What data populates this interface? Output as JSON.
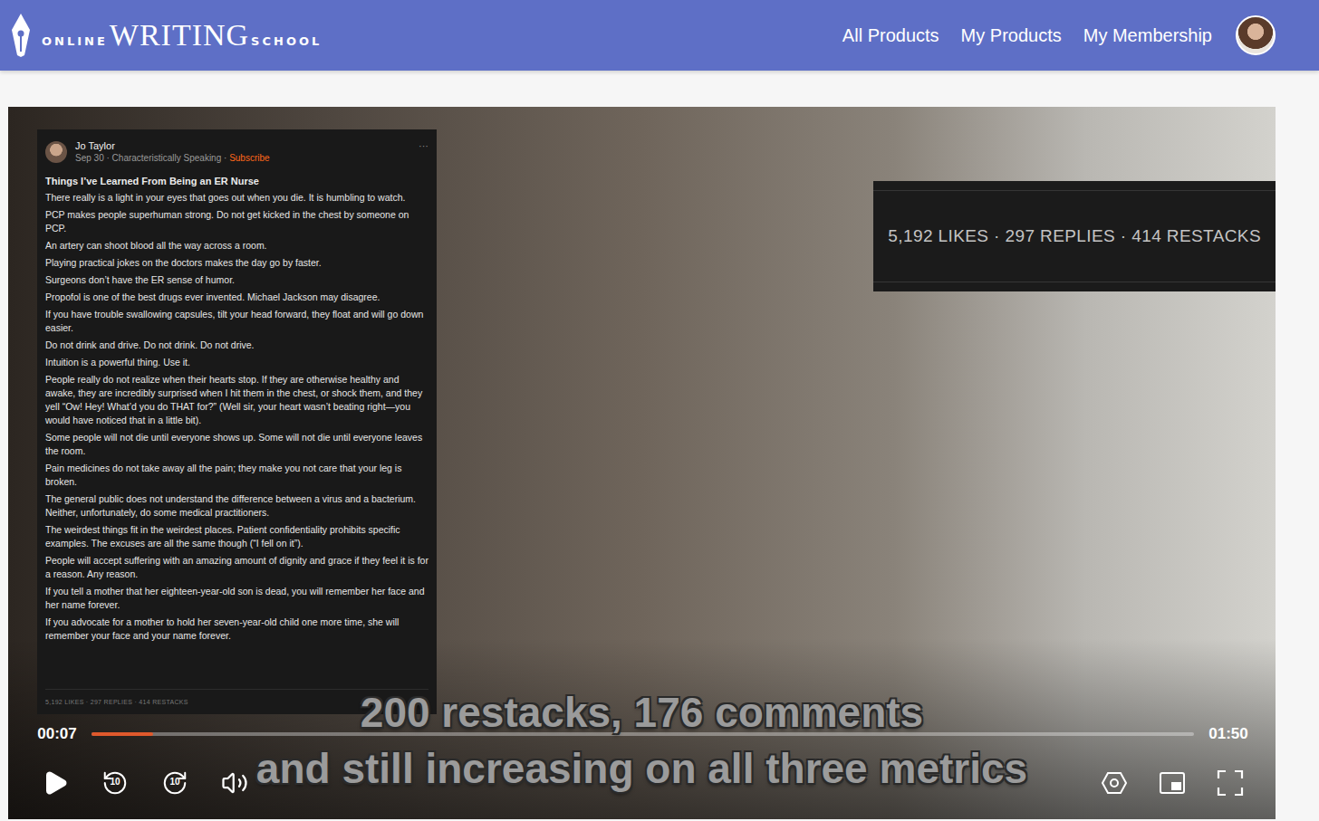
{
  "header": {
    "logo": {
      "prefix": "ONLINE",
      "main": "WRITING",
      "suffix": "SCHOOL"
    },
    "nav": [
      {
        "label": "All Products",
        "selected": false
      },
      {
        "label": "My Products",
        "selected": false
      },
      {
        "label": "My Membership",
        "selected": false
      }
    ]
  },
  "video": {
    "note": {
      "author": "Jo Taylor",
      "date": "Sep 30",
      "separator": "·",
      "publication": "Characteristically Speaking",
      "subscribe": "Subscribe",
      "more": "···",
      "title": "Things I’ve Learned From Being an ER Nurse",
      "items": [
        "There really is a light in your eyes that goes out when you die. It is humbling to watch.",
        "PCP makes people superhuman strong. Do not get kicked in the chest by someone on PCP.",
        "An artery can shoot blood all the way across a room.",
        "Playing practical jokes on the doctors makes the day go by faster.",
        "Surgeons don’t have the ER sense of humor.",
        "Propofol is one of the best drugs ever invented. Michael Jackson may disagree.",
        "If you have trouble swallowing capsules, tilt your head forward, they float and will go down easier.",
        "Do not drink and drive. Do not drink. Do not drive.",
        "Intuition is a powerful thing. Use it.",
        "People really do not realize when their hearts stop. If they are otherwise healthy and awake, they are incredibly surprised when I hit them in the chest, or shock them, and they yell “Ow! Hey! What’d you do THAT for?” (Well sir, your heart wasn’t beating right—you would have noticed that in a little bit).",
        "Some people will not die until everyone shows up. Some will not die until everyone leaves the room.",
        "Pain medicines do not take away all the pain; they make you not care that your leg is broken.",
        "The general public does not understand the difference between a virus and a bacterium. Neither, unfortunately, do some medical practitioners.",
        "The weirdest things fit in the weirdest places. Patient confidentiality prohibits specific examples. The excuses are all the same though (“I fell on it”).",
        "People will accept suffering with an amazing amount of dignity and grace if they feel it is for a reason. Any reason.",
        "If you tell a mother that her eighteen-year-old son is dead, you will remember her face and her name forever.",
        "If you advocate for a mother to hold her seven-year-old child one more time, she will remember your face and your name forever."
      ],
      "footer": "5,192 LIKES · 297 REPLIES · 414 RESTACKS"
    },
    "stats": "5,192 LIKES · 297 REPLIES · 414 RESTACKS",
    "captions": [
      "200 restacks, 176 comments",
      "and still increasing on all three metrics"
    ]
  },
  "player": {
    "current": "00:07",
    "duration": "01:50",
    "level": 0.056,
    "playing": false,
    "rewind": "10",
    "forward": "10"
  }
}
